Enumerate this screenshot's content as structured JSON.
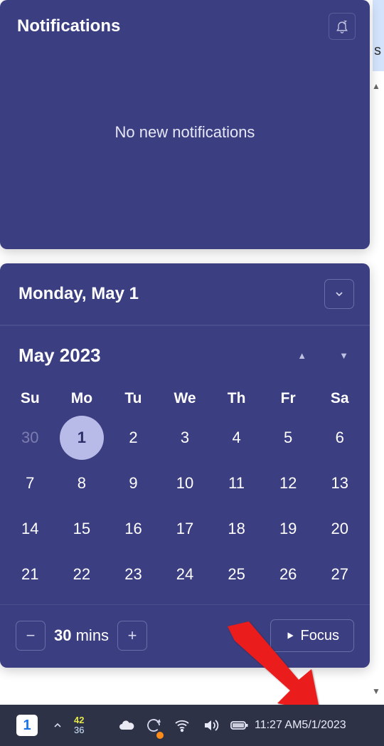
{
  "notifications": {
    "title": "Notifications",
    "empty_msg": "No new notifications"
  },
  "calendar": {
    "selected_date_label": "Monday, May 1",
    "month_label": "May 2023",
    "dow": [
      "Su",
      "Mo",
      "Tu",
      "We",
      "Th",
      "Fr",
      "Sa"
    ],
    "weeks": [
      [
        {
          "d": "30",
          "other": true
        },
        {
          "d": "1",
          "today": true
        },
        {
          "d": "2"
        },
        {
          "d": "3"
        },
        {
          "d": "4"
        },
        {
          "d": "5"
        },
        {
          "d": "6"
        }
      ],
      [
        {
          "d": "7"
        },
        {
          "d": "8"
        },
        {
          "d": "9"
        },
        {
          "d": "10"
        },
        {
          "d": "11"
        },
        {
          "d": "12"
        },
        {
          "d": "13"
        }
      ],
      [
        {
          "d": "14"
        },
        {
          "d": "15"
        },
        {
          "d": "16"
        },
        {
          "d": "17"
        },
        {
          "d": "18"
        },
        {
          "d": "19"
        },
        {
          "d": "20"
        }
      ],
      [
        {
          "d": "21"
        },
        {
          "d": "22"
        },
        {
          "d": "23"
        },
        {
          "d": "24"
        },
        {
          "d": "25"
        },
        {
          "d": "26"
        },
        {
          "d": "27"
        }
      ]
    ],
    "focus": {
      "duration_value": "30",
      "duration_unit": "mins",
      "button_label": "Focus"
    }
  },
  "taskbar": {
    "app_badge": "1",
    "weather_hi": "42",
    "weather_lo": "36",
    "time": "11:27 AM",
    "date": "5/1/2023"
  },
  "stray_char": "s",
  "colors": {
    "panel_bg": "#3b3e80",
    "today_bg": "#b8bbe8",
    "taskbar_bg": "#2e3247",
    "arrow": "#ea1b1b"
  }
}
